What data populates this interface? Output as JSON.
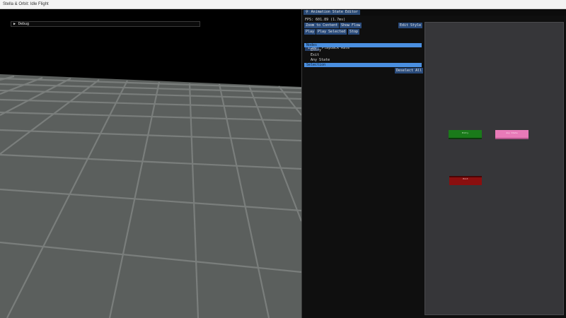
{
  "window": {
    "title": "Stella & Orbit: Idle Flight"
  },
  "debug_window": {
    "arrow_icon": "triangle-right-icon",
    "title": "Debug"
  },
  "editor": {
    "title": "Animation State Editor",
    "pin_icon": "pin-icon",
    "fps": "FPS: 601.89 (1.7ms)",
    "buttons": {
      "zoom_to_content": "Zoom to Content",
      "show_flow": "Show Flow",
      "edit_style": "Edit Style",
      "play": "Play",
      "play_selected": "Play Selected",
      "stop": "Stop",
      "deselect_all": "Deselect All"
    },
    "playback": {
      "value": "1.00",
      "label": "Playback Rate"
    },
    "nodes_header": "Nodes",
    "nodes_list": [
      "Entry",
      "Exit",
      "Any State"
    ],
    "selection_header": "Selection"
  },
  "graph": {
    "nodes": [
      {
        "label": "Entry",
        "color": "#1a7a1a"
      },
      {
        "label": "Any State",
        "color": "#e87ab8"
      },
      {
        "label": "Exit",
        "color": "#8a0f0f"
      }
    ]
  },
  "colors": {
    "accent_header": "#4a8fe0",
    "button": "#294a7a",
    "floor": "#5b5f5d",
    "floor_lines": "#7a7e7c"
  }
}
